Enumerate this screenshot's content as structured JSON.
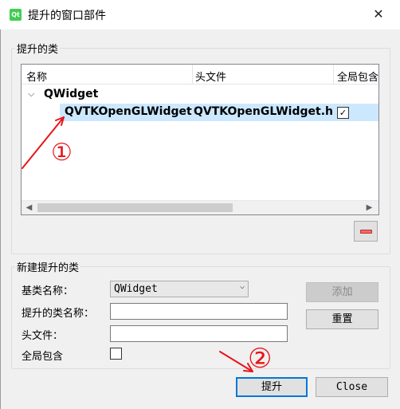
{
  "window": {
    "title": "提升的窗口部件",
    "app_icon_text": "Qt",
    "close_glyph": "✕"
  },
  "promoted_group": {
    "legend": "提升的类",
    "columns": [
      "名称",
      "头文件",
      "全局包含"
    ],
    "parent_item": "QWidget",
    "rows": [
      {
        "name": "QVTKOpenGLWidget",
        "header": "QVTKOpenGLWidget.h",
        "global_include": true,
        "selected": true
      }
    ]
  },
  "new_group": {
    "legend": "新建提升的类",
    "base_class_label": "基类名称：",
    "base_class_value": "QWidget",
    "class_name_label": "提升的类名称：",
    "class_name_value": "",
    "header_label": "头文件：",
    "header_value": "",
    "global_label": "全局包含",
    "global_checked": false
  },
  "buttons": {
    "add": "添加",
    "reset": "重置",
    "promote": "提升",
    "close": "Close"
  },
  "annotations": {
    "note_1": "①",
    "note_2": "②",
    "color": "#e8141a"
  },
  "colors": {
    "selection": "#cce8ff",
    "default_button_border": "#0078d7"
  }
}
